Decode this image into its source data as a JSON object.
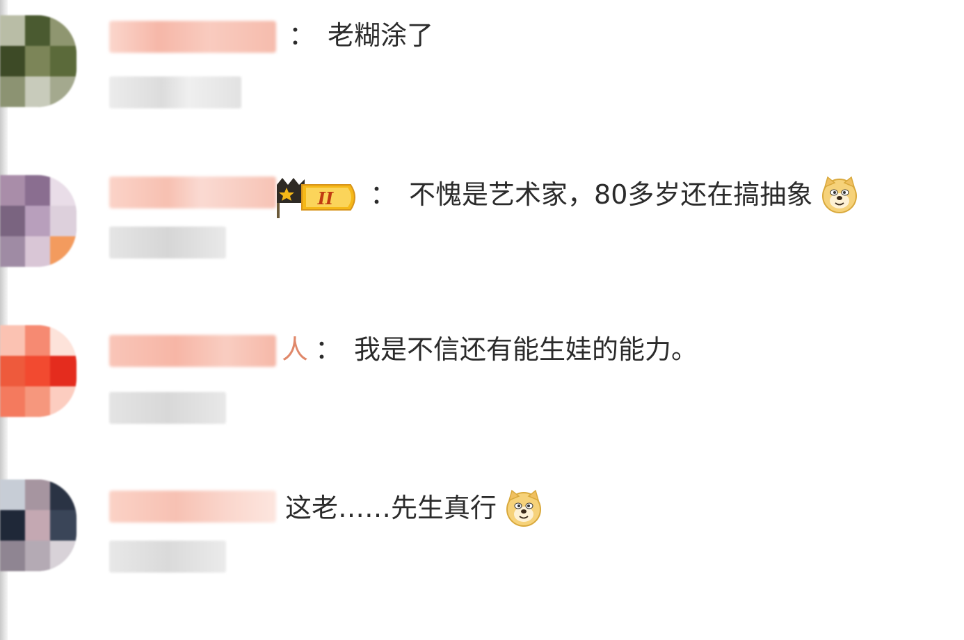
{
  "comments": [
    {
      "avatar_colors": [
        "#5d6b3e",
        "#8a8f6b",
        "#b5b89d",
        "#3f4d2a"
      ],
      "name_visible_suffix": "",
      "text": "老糊涂了",
      "emoji": ""
    },
    {
      "avatar_colors": [
        "#9a7fa0",
        "#c8b6c9",
        "#f1a070",
        "#d9c2d6"
      ],
      "name_visible_suffix": "",
      "badge_level": "II",
      "text": "不愧是艺术家，80多岁还在搞抽象",
      "emoji": "doge-icon"
    },
    {
      "avatar_colors": [
        "#f2553a",
        "#f8a08e",
        "#e33822",
        "#fcd2c4"
      ],
      "name_visible_suffix": "人",
      "text": "我是不信还有能生娃的能力。",
      "emoji": ""
    },
    {
      "avatar_colors": [
        "#3a4558",
        "#8c7f8a",
        "#c9b8c0",
        "#1f2838"
      ],
      "name_visible_suffix": "",
      "text": "这老……先生真行",
      "emoji": "doge-icon"
    }
  ],
  "colon": "：",
  "colors": {
    "text": "#2b2b2b",
    "name_blur": "#f7c9bf",
    "meta_blur": "#e6e6e6",
    "badge_gold": "#f5b818"
  }
}
